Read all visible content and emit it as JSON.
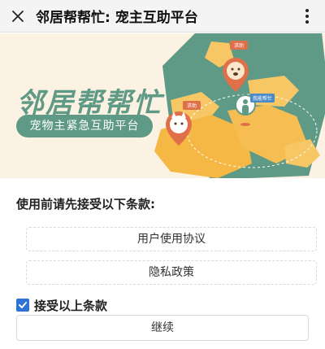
{
  "header": {
    "title": "邻居帮帮忙: 宠主互助平台",
    "close_icon": "close-icon",
    "more_icon": "more-vertical-icon"
  },
  "banner": {
    "title": "邻居帮帮忙",
    "subtitle": "宠物主紧急互助平台",
    "tags": {
      "help_top": "求助",
      "help_left": "求助",
      "can_help": "我能帮忙"
    },
    "colors": {
      "background": "#fbf2e3",
      "teal": "#5f9a86",
      "orange": "#f5b845",
      "pin": "#e0704a"
    }
  },
  "terms": {
    "heading": "使用前请先接受以下条款:",
    "documents": [
      "用户使用协议",
      "隐私政策"
    ],
    "agree_label": "接受以上条款",
    "agree_checked": true,
    "continue_label": "继续"
  }
}
